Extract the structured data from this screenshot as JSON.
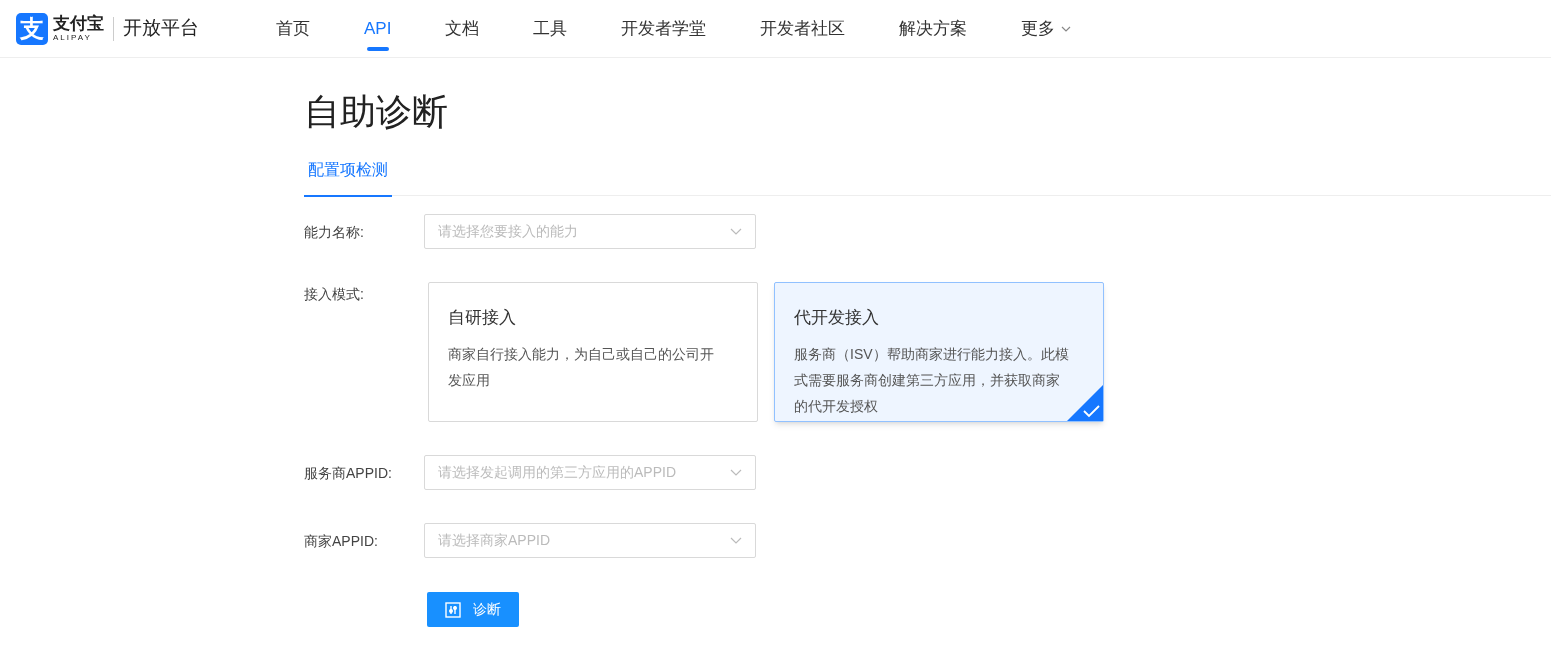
{
  "header": {
    "logo": {
      "mark": "支",
      "name": "支付宝",
      "sub": "ALIPAY",
      "product": "开放平台"
    },
    "nav": [
      {
        "label": "首页",
        "selected": false
      },
      {
        "label": "API",
        "selected": true
      },
      {
        "label": "文档",
        "selected": false
      },
      {
        "label": "工具",
        "selected": false
      },
      {
        "label": "开发者学堂",
        "selected": false
      },
      {
        "label": "开发者社区",
        "selected": false
      },
      {
        "label": "解决方案",
        "selected": false
      },
      {
        "label": "更多",
        "selected": false,
        "dropdown": true
      }
    ]
  },
  "page": {
    "title": "自助诊断",
    "tabs": [
      {
        "label": "配置项检测",
        "selected": true
      }
    ]
  },
  "form": [
    {
      "kind": "select",
      "label": "能力名称:",
      "placeholder": "请选择您要接入的能力"
    },
    {
      "kind": "cards",
      "label": "接入模式:",
      "options": [
        {
          "title": "自研接入",
          "description": "商家自行接入能力，为自己或自己的公司开发应用",
          "selected": false
        },
        {
          "title": "代开发接入",
          "description": "服务商（ISV）帮助商家进行能力接入。此模式需要服务商创建第三方应用，并获取商家的代开发授权",
          "selected": true
        }
      ]
    },
    {
      "kind": "select",
      "label": "服务商APPID:",
      "placeholder": "请选择发起调用的第三方应用的APPID"
    },
    {
      "kind": "select",
      "label": "商家APPID:",
      "placeholder": "请选择商家APPID"
    }
  ],
  "submit": {
    "label": "诊断"
  }
}
